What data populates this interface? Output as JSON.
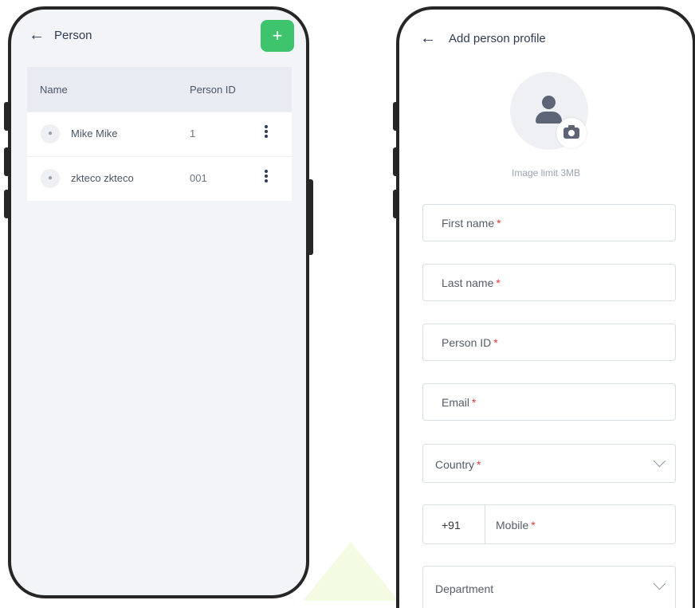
{
  "person_list": {
    "title": "Person",
    "back_icon": "arrow-left-icon",
    "add_icon": "plus-icon",
    "add_symbol": "+",
    "add_color": "#3ec46d",
    "columns": [
      "Name",
      "Person ID"
    ],
    "rows": [
      {
        "name": "Mike Mike",
        "id": "1"
      },
      {
        "name": "zkteco zkteco",
        "id": "001"
      }
    ]
  },
  "add_profile": {
    "title": "Add person profile",
    "back_icon": "arrow-left-icon",
    "photo_icon": "user-icon",
    "camera_icon": "camera-icon",
    "image_limit": "Image limit 3MB",
    "required_mark": "*",
    "required_color": "#e53935",
    "fields": {
      "first_name": "First name",
      "last_name": "Last name",
      "person_id": "Person ID",
      "email": "Email",
      "country": "Country",
      "country_code": "+91",
      "mobile": "Mobile",
      "department": "Department"
    }
  }
}
